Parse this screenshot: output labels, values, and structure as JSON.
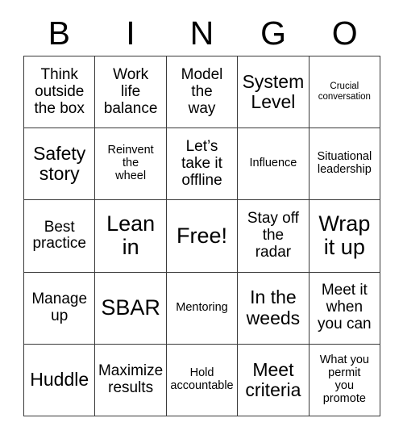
{
  "card": {
    "header_letters": [
      "B",
      "I",
      "N",
      "G",
      "O"
    ],
    "rows": [
      [
        {
          "text": "Think\noutside\nthe box",
          "size": "md"
        },
        {
          "text": "Work\nlife\nbalance",
          "size": "md"
        },
        {
          "text": "Model\nthe\nway",
          "size": "md"
        },
        {
          "text": "System\nLevel",
          "size": "lg"
        },
        {
          "text": "Crucial\nconversation",
          "size": "xs"
        }
      ],
      [
        {
          "text": "Safety\nstory",
          "size": "lg"
        },
        {
          "text": "Reinvent\nthe\nwheel",
          "size": "sm"
        },
        {
          "text": "Let’s\ntake it\noffline",
          "size": "md"
        },
        {
          "text": "Influence",
          "size": "sm"
        },
        {
          "text": "Situational\nleadership",
          "size": "sm"
        }
      ],
      [
        {
          "text": "Best\npractice",
          "size": "md"
        },
        {
          "text": "Lean\nin",
          "size": "xl"
        },
        {
          "text": "Free!",
          "size": "xl"
        },
        {
          "text": "Stay off\nthe\nradar",
          "size": "md"
        },
        {
          "text": "Wrap\nit up",
          "size": "xl"
        }
      ],
      [
        {
          "text": "Manage\nup",
          "size": "md"
        },
        {
          "text": "SBAR",
          "size": "xl"
        },
        {
          "text": "Mentoring",
          "size": "sm"
        },
        {
          "text": "In the\nweeds",
          "size": "lg"
        },
        {
          "text": "Meet it\nwhen\nyou can",
          "size": "md"
        }
      ],
      [
        {
          "text": "Huddle",
          "size": "lg"
        },
        {
          "text": "Maximize\nresults",
          "size": "md"
        },
        {
          "text": "Hold\naccountable",
          "size": "sm"
        },
        {
          "text": "Meet\ncriteria",
          "size": "lg"
        },
        {
          "text": "What you\npermit\nyou\npromote",
          "size": "sm"
        }
      ]
    ]
  },
  "colors": {
    "background": "#ffffff",
    "text": "#000000",
    "grid_line": "#3a3a3a"
  }
}
